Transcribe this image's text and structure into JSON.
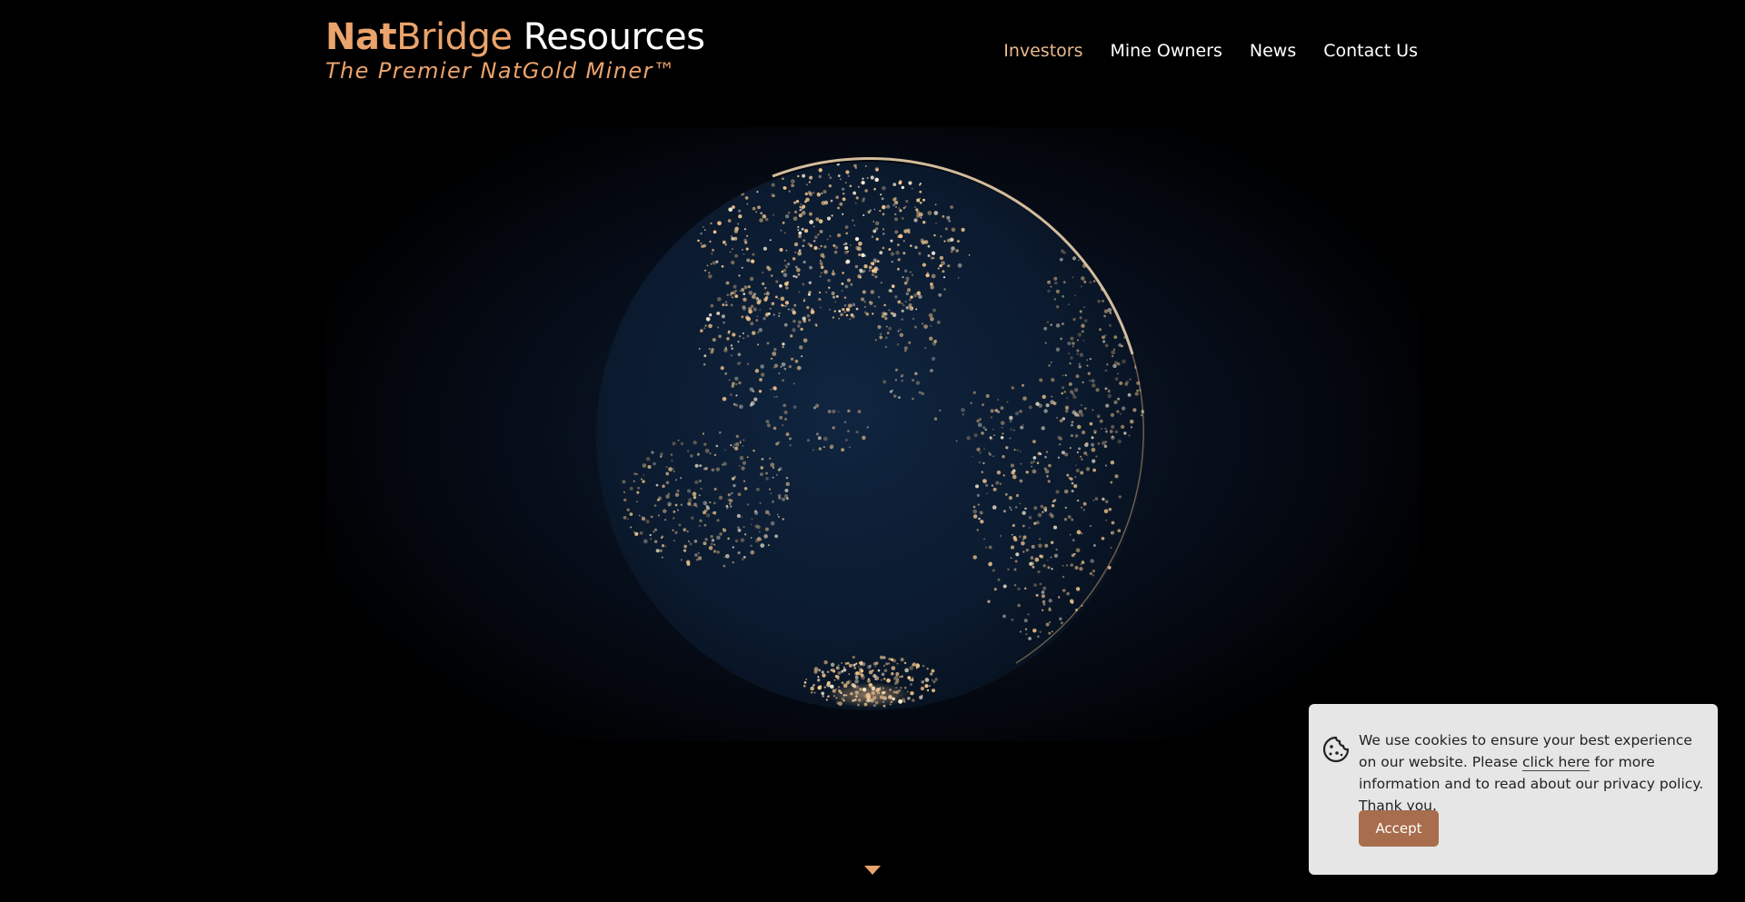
{
  "header": {
    "logo": {
      "part1": "Nat",
      "part2": "Bridge",
      "part3": " Resources",
      "tagline": "The Premier NatGold Miner™"
    },
    "nav": [
      {
        "label": "Investors",
        "active": true
      },
      {
        "label": "Mine Owners",
        "active": false
      },
      {
        "label": "News",
        "active": false
      },
      {
        "label": "Contact Us",
        "active": false
      }
    ]
  },
  "hero": {
    "image": "globe with city lights"
  },
  "scroll": {
    "icon": "chevron-down-icon"
  },
  "cookie_banner": {
    "icon": "cookie-icon",
    "text_before": "We use cookies to ensure your best experience on our website. Please ",
    "link_label": "click here",
    "text_after": " for more information and to read about our privacy policy. Thank you.",
    "accept_label": "Accept"
  },
  "colors": {
    "brand_gold": "#eba36c",
    "nav_active": "#e8b98c",
    "accept_button": "#a86d4c",
    "banner_bg": "#e6e6e6"
  }
}
